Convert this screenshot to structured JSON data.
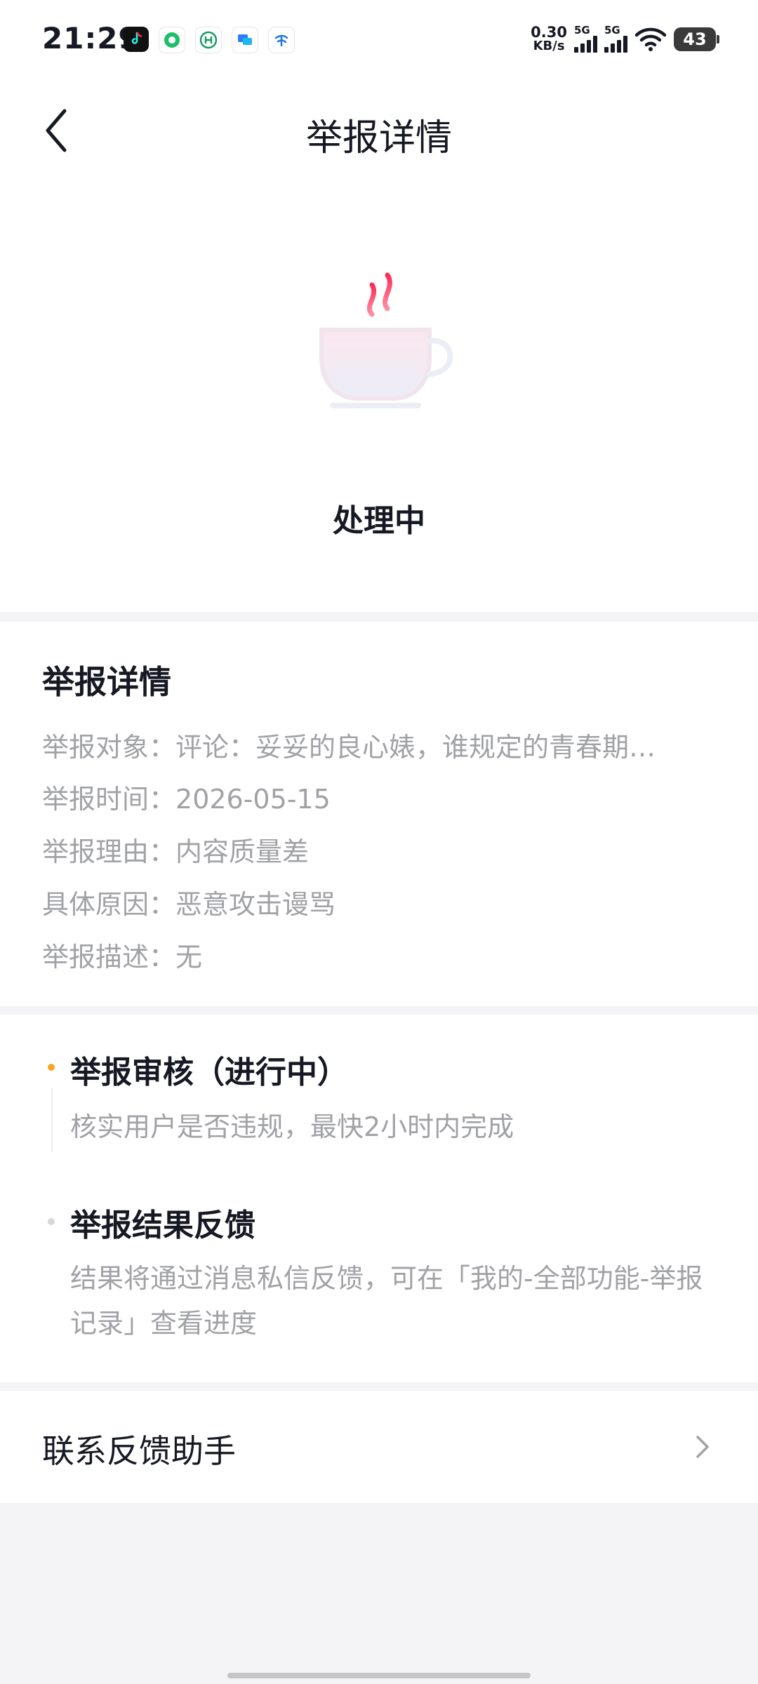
{
  "status_bar": {
    "time": "21:29",
    "net_speed_value": "0.30",
    "net_speed_unit": "KB/s",
    "sim1_label": "5G",
    "sim2_label": "5G",
    "battery": "43",
    "app_icons": [
      "douyin-icon",
      "green-app-icon",
      "bank-app-icon",
      "message-app-icon",
      "telecom-icon"
    ]
  },
  "header": {
    "title": "举报详情"
  },
  "hero": {
    "status": "处理中",
    "illustration": "coffee-cup-icon"
  },
  "details": {
    "title": "举报详情",
    "rows": [
      {
        "label": "举报对象：",
        "value": "评论：妥妥的良心婊，谁规定的青春期…"
      },
      {
        "label": "举报时间：",
        "value": "2026-05-15"
      },
      {
        "label": "举报理由：",
        "value": "内容质量差"
      },
      {
        "label": "具体原因：",
        "value": "恶意攻击谩骂"
      },
      {
        "label": "举报描述：",
        "value": "无"
      }
    ]
  },
  "timeline": {
    "steps": [
      {
        "title": "举报审核（进行中）",
        "desc": "核实用户是否违规，最快2小时内完成",
        "active": true
      },
      {
        "title": "举报结果反馈",
        "desc": "结果将通过消息私信反馈，可在「我的-全部功能-举报记录」查看进度",
        "active": false
      }
    ]
  },
  "contact": {
    "label": "联系反馈助手"
  },
  "colors": {
    "accent_orange": "#f5a623",
    "text_primary": "#161823",
    "text_secondary": "#a1a2a6",
    "background": "#f4f4f6"
  }
}
